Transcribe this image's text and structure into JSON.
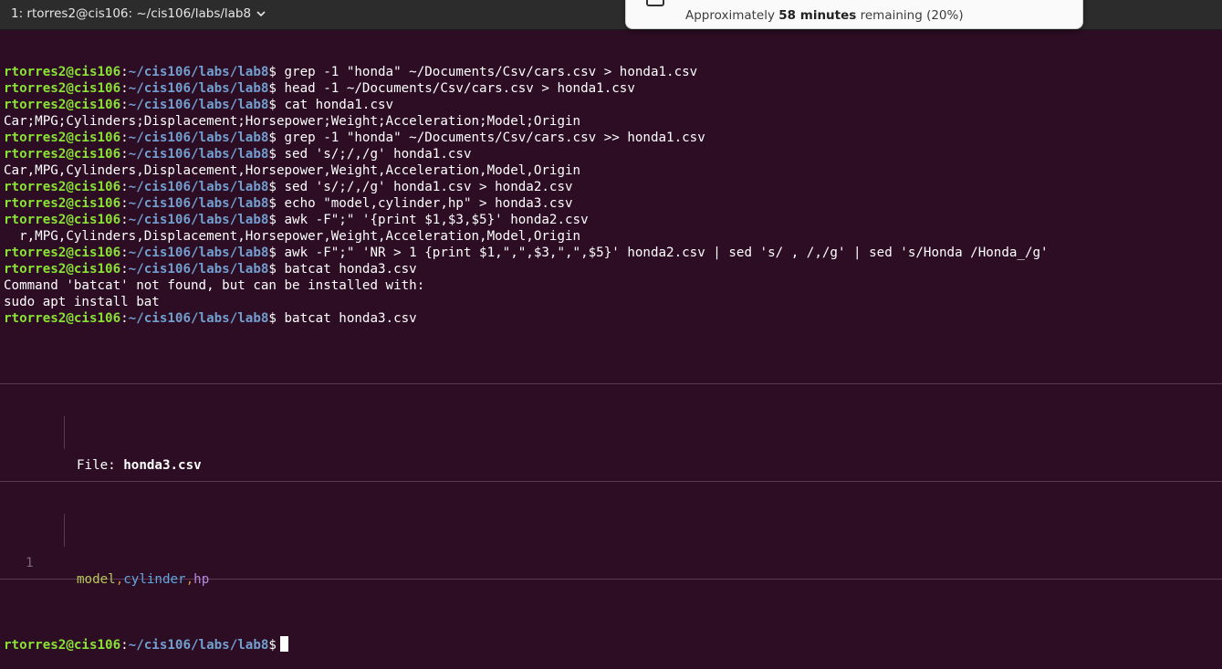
{
  "window": {
    "tab_title": "1: rtorres2@cis106: ~/cis106/labs/lab8"
  },
  "notification": {
    "prefix": "Approximately ",
    "bold": "58 minutes",
    "suffix": " remaining (20%)"
  },
  "prompt": {
    "user_host": "rtorres2@cis106",
    "colon": ":",
    "path": "~/cis106/labs/lab8",
    "dollar": "$"
  },
  "lines_before": [
    {
      "kind": "cmd",
      "text": " grep -1 \"honda\" ~/Documents/Csv/cars.csv > honda1.csv"
    },
    {
      "kind": "cmd",
      "text": " head -1 ~/Documents/Csv/cars.csv > honda1.csv"
    },
    {
      "kind": "cmd",
      "text": " cat honda1.csv"
    },
    {
      "kind": "out",
      "text": "Car;MPG;Cylinders;Displacement;Horsepower;Weight;Acceleration;Model;Origin"
    },
    {
      "kind": "cmd",
      "text": " grep -1 \"honda\" ~/Documents/Csv/cars.csv >> honda1.csv"
    },
    {
      "kind": "cmd",
      "text": " sed 's/;/,/g' honda1.csv"
    },
    {
      "kind": "out",
      "text": "Car,MPG,Cylinders,Displacement,Horsepower,Weight,Acceleration,Model,Origin"
    },
    {
      "kind": "cmd",
      "text": " sed 's/;/,/g' honda1.csv > honda2.csv"
    },
    {
      "kind": "cmd",
      "text": " echo \"model,cylinder,hp\" > honda3.csv"
    },
    {
      "kind": "cmd",
      "text": " awk -F\";\" '{print $1,$3,$5}' honda2.csv"
    },
    {
      "kind": "out",
      "text": "  r,MPG,Cylinders,Displacement,Horsepower,Weight,Acceleration,Model,Origin"
    },
    {
      "kind": "cmd",
      "text": " awk -F\";\" 'NR > 1 {print $1,\",\",$3,\",\",$5}' honda2.csv | sed 's/ , /,/g' | sed 's/Honda /Honda_/g'"
    },
    {
      "kind": "cmd",
      "text": " batcat honda3.csv"
    },
    {
      "kind": "out",
      "text": "Command 'batcat' not found, but can be installed with:"
    },
    {
      "kind": "out",
      "text": "sudo apt install bat"
    },
    {
      "kind": "cmd",
      "text": " batcat honda3.csv"
    }
  ],
  "bat": {
    "file_label": "File: ",
    "file_name": "honda3.csv",
    "line_number": "1",
    "tokens": {
      "model": "model",
      "sep1": ",",
      "cylinder": "cylinder",
      "sep2": ",",
      "hp": "hp"
    }
  }
}
